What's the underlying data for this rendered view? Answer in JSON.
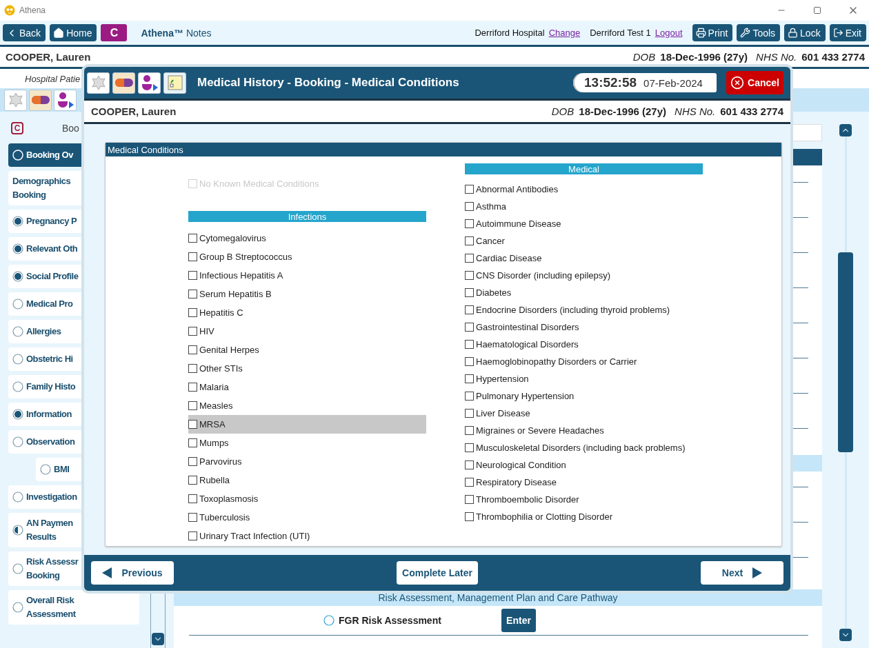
{
  "window": {
    "title": "Athena"
  },
  "toolbar": {
    "left_buttons": [
      "Back",
      "Home"
    ],
    "badge": "C",
    "app_name": "Athena™",
    "app_section": "Notes",
    "location": "Derriford Hospital",
    "location_link": "Change",
    "user": "Derriford Test 1",
    "user_link": "Logout",
    "right_buttons": [
      "Print",
      "Tools",
      "Lock",
      "Exit"
    ]
  },
  "patient": {
    "name": "COOPER, Lauren",
    "dob_label": "DOB",
    "dob": "18-Dec-1996 (27y)",
    "nhs_label": "NHS No.",
    "nhs": "601 433 2774"
  },
  "sub_header": "Hospital Patie",
  "sidebar": {
    "badge": "C",
    "title": "Boo",
    "items": [
      {
        "label": "Booking Ov",
        "complete": false,
        "partial": false,
        "selected": true
      },
      {
        "label": "Demographics Booking",
        "selected": false
      },
      {
        "label": "Pregnancy P",
        "complete": true,
        "partial": false,
        "selected": false
      },
      {
        "label": "Relevant Oth",
        "complete": true,
        "partial": false,
        "selected": false
      },
      {
        "label": "Social Profile",
        "complete": true,
        "partial": false,
        "selected": false
      },
      {
        "label": "Medical Pro",
        "complete": false,
        "partial": false,
        "selected": false
      },
      {
        "label": "Allergies",
        "complete": false,
        "partial": false,
        "selected": false
      },
      {
        "label": "Obstetric Hi",
        "complete": false,
        "partial": false,
        "selected": false
      },
      {
        "label": "Family Histo",
        "complete": false,
        "partial": false,
        "selected": false
      },
      {
        "label": "Information",
        "complete": true,
        "partial": false,
        "selected": false
      },
      {
        "label": "Observation",
        "complete": false,
        "partial": false,
        "selected": false,
        "children": [
          {
            "label": "BMI",
            "complete": false,
            "partial": false,
            "selected": false
          }
        ]
      },
      {
        "label": "Investigation",
        "complete": false,
        "partial": false,
        "selected": false
      },
      {
        "label": "AN Paymen Results",
        "complete": false,
        "partial": true,
        "selected": false
      },
      {
        "label": "Risk Assessr Booking",
        "complete": false,
        "partial": false,
        "selected": false
      },
      {
        "label": "Overall Risk Assessment",
        "complete": false,
        "partial": false,
        "selected": false
      }
    ]
  },
  "content": {
    "section_band": "Risk Assessment, Management Plan and Care Pathway",
    "rows": [
      {
        "label": "FGR Risk Assessment",
        "action": "Enter",
        "complete": false
      }
    ]
  },
  "modal": {
    "title": "Medical History - Booking - Medical Conditions",
    "time": "13:52:58",
    "date": "07-Feb-2024",
    "cancel": "Cancel",
    "patient": {
      "name": "COOPER, Lauren",
      "dob_label": "DOB",
      "dob": "18-Dec-1996 (27y)",
      "nhs_label": "NHS No.",
      "nhs": "601 433 2774"
    },
    "panel_title": "Medical Conditions",
    "none_option": {
      "label": "No Known Medical Conditions",
      "checked": false,
      "disabled": true
    },
    "infections": {
      "title": "Infections",
      "items": [
        {
          "label": "Cytomegalovirus",
          "checked": false,
          "selected": false
        },
        {
          "label": "Group B Streptococcus",
          "checked": false,
          "selected": false
        },
        {
          "label": "Infectious Hepatitis A",
          "checked": false,
          "selected": false
        },
        {
          "label": "Serum Hepatitis B",
          "checked": false,
          "selected": false
        },
        {
          "label": "Hepatitis C",
          "checked": false,
          "selected": false
        },
        {
          "label": "HIV",
          "checked": false,
          "selected": false
        },
        {
          "label": "Genital Herpes",
          "checked": false,
          "selected": false
        },
        {
          "label": "Other STIs",
          "checked": false,
          "selected": false
        },
        {
          "label": "Malaria",
          "checked": false,
          "selected": false
        },
        {
          "label": "Measles",
          "checked": false,
          "selected": false
        },
        {
          "label": "MRSA",
          "checked": false,
          "selected": true
        },
        {
          "label": "Mumps",
          "checked": false,
          "selected": false
        },
        {
          "label": "Parvovirus",
          "checked": false,
          "selected": false
        },
        {
          "label": "Rubella",
          "checked": false,
          "selected": false
        },
        {
          "label": "Toxoplasmosis",
          "checked": false,
          "selected": false
        },
        {
          "label": "Tuberculosis",
          "checked": false,
          "selected": false
        },
        {
          "label": "Urinary Tract Infection (UTI)",
          "checked": false,
          "selected": false
        }
      ]
    },
    "medical": {
      "title": "Medical",
      "items": [
        {
          "label": "Abnormal Antibodies",
          "checked": false
        },
        {
          "label": "Asthma",
          "checked": false
        },
        {
          "label": "Autoimmune Disease",
          "checked": false
        },
        {
          "label": "Cancer",
          "checked": false
        },
        {
          "label": "Cardiac Disease",
          "checked": false
        },
        {
          "label": "CNS Disorder (including epilepsy)",
          "checked": false
        },
        {
          "label": "Diabetes",
          "checked": false
        },
        {
          "label": "Endocrine Disorders (including thyroid problems)",
          "checked": false
        },
        {
          "label": "Gastrointestinal Disorders",
          "checked": false
        },
        {
          "label": "Haematological Disorders",
          "checked": false
        },
        {
          "label": "Haemoglobinopathy Disorders or Carrier",
          "checked": false
        },
        {
          "label": "Hypertension",
          "checked": false
        },
        {
          "label": "Pulmonary Hypertension",
          "checked": false
        },
        {
          "label": "Liver Disease",
          "checked": false
        },
        {
          "label": "Migraines or Severe Headaches",
          "checked": false
        },
        {
          "label": "Musculoskeletal Disorders (including back problems)",
          "checked": false
        },
        {
          "label": "Neurological Condition",
          "checked": false
        },
        {
          "label": "Respiratory Disease",
          "checked": false
        },
        {
          "label": "Thromboembolic Disorder",
          "checked": false
        },
        {
          "label": "Thrombophilia or Clotting Disorder",
          "checked": false
        }
      ]
    },
    "footer": {
      "previous": "Previous",
      "later": "Complete Later",
      "next": "Next"
    }
  }
}
